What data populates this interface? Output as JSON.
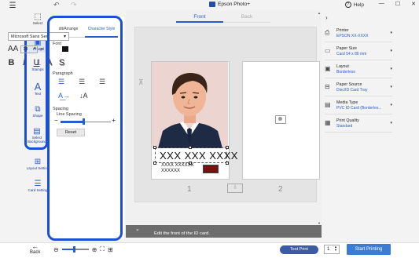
{
  "titlebar": {
    "app_title": "Epson Photo+",
    "help_label": "Help",
    "menu_icon": "hamburger-icon",
    "undo_icon": "undo-icon",
    "redo_icon": "redo-icon",
    "min_glyph": "—",
    "max_glyph": "☐",
    "close_glyph": "✕"
  },
  "rail": {
    "items": [
      {
        "label": "Select",
        "icon": "select-icon"
      },
      {
        "label": "Photo",
        "icon": "photo-icon"
      },
      {
        "label": "Stamps",
        "icon": "stamps-icon"
      },
      {
        "label": "Text",
        "icon": "text-icon"
      },
      {
        "label": "Shape",
        "icon": "shape-icon"
      },
      {
        "label": "Select Background",
        "icon": "background-icon"
      },
      {
        "label": "Layout Setting",
        "icon": "layout-icon"
      },
      {
        "label": "Card Setting",
        "icon": "card-setting-icon"
      }
    ]
  },
  "panel": {
    "tabs": [
      {
        "label": "dit/Arrange",
        "active": false
      },
      {
        "label": "Character Style",
        "active": true
      }
    ],
    "font_label": "Font",
    "font_value": "Microsoft Sans Serif",
    "size_value": "18",
    "size_unit": "pt",
    "text_color": "#111111",
    "style_buttons": [
      "B",
      "I",
      "U",
      "A",
      "S"
    ],
    "paragraph_label": "Paragraph",
    "spacing_label": "Spacing",
    "line_spacing_label": "Line Spacing",
    "line_spacing_fraction": 0.45,
    "reset_label": "Reset"
  },
  "canvas": {
    "tabs": [
      {
        "label": "Front",
        "active": true
      },
      {
        "label": "Back",
        "active": false
      }
    ],
    "card_text_main": "XXX XXX XXXX",
    "card_text_sub_1": "XXXX XXXXXX",
    "card_text_sub_2": "XXXXXX",
    "card_numbers": [
      "1",
      "2"
    ],
    "hint": "Edit the front of the ID card."
  },
  "settings": [
    {
      "name": "Printer",
      "value": "EPSON XX-XXXX",
      "icon": "printer-icon"
    },
    {
      "name": "Paper Size",
      "value": "Card 54 x 86 mm",
      "icon": "paper-size-icon"
    },
    {
      "name": "Layout",
      "value": "Borderless",
      "icon": "layout-icon"
    },
    {
      "name": "Paper Source",
      "value": "Disc/ID Card Tray",
      "icon": "paper-source-icon"
    },
    {
      "name": "Media Type",
      "value": "PVC ID Card (Borderles...",
      "icon": "media-type-icon"
    },
    {
      "name": "Print Quality",
      "value": "Standard",
      "icon": "print-quality-icon"
    }
  ],
  "bottom": {
    "back_label": "Back",
    "zoom_fraction": 0.45,
    "test_print_label": "Test Print",
    "copies_value": "1",
    "start_label": "Start Printing"
  },
  "colors": {
    "accent": "#2a5bd0",
    "highlight": "#1b4fd6",
    "start_button": "#3a7bd5",
    "test_button": "#3d5aa8"
  }
}
